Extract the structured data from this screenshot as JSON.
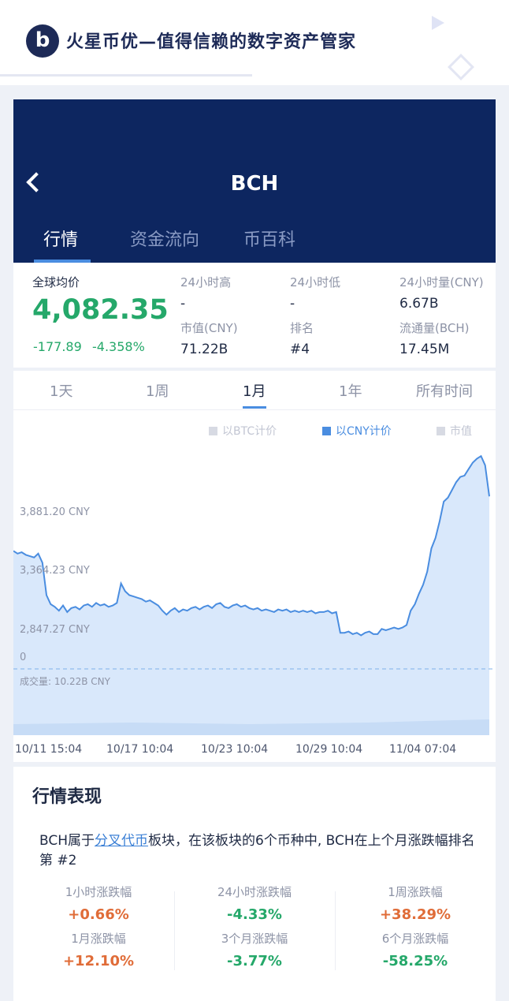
{
  "banner": {
    "logo_letter": "b",
    "title": "火星币优—值得信赖的数字资产管家"
  },
  "header": {
    "coin": "BCH",
    "tabs": [
      "行情",
      "资金流向",
      "币百科"
    ]
  },
  "stats": {
    "global_label": "全球均价",
    "price": "4,082.35",
    "change_abs": "-177.89",
    "change_pct": "-4.358%",
    "high_label": "24小时高",
    "high_value": "-",
    "low_label": "24小时低",
    "low_value": "-",
    "volume_label": "24小时量(CNY)",
    "volume_value": "6.67B",
    "mcap_label": "市值(CNY)",
    "mcap_value": "71.22B",
    "rank_label": "排名",
    "rank_value": "#4",
    "supply_label": "流通量(BCH)",
    "supply_value": "17.45M"
  },
  "ranges": {
    "items": [
      "1天",
      "1周",
      "1月",
      "1年",
      "所有时间"
    ],
    "active": "1月"
  },
  "chart_data": {
    "type": "area",
    "legend": [
      "以BTC计价",
      "以CNY计价",
      "市值"
    ],
    "active_series": "以CNY计价",
    "y_ticks": [
      "3,881.20 CNY",
      "3,364.23 CNY",
      "2,847.27 CNY",
      "0"
    ],
    "volume_label": "成交量: 10.22B CNY",
    "x_ticks": [
      "10/11 15:04",
      "10/17 10:04",
      "10/23 10:04",
      "10/29 10:04",
      "11/04 07:04"
    ],
    "ylim": [
      2500,
      4200
    ],
    "series": [
      {
        "name": "以CNY计价",
        "values": [
          3420,
          3400,
          3410,
          3390,
          3380,
          3370,
          3400,
          3330,
          3080,
          3010,
          2990,
          2960,
          3000,
          2950,
          2980,
          2990,
          2970,
          3000,
          3010,
          2990,
          3020,
          3000,
          3010,
          2990,
          3000,
          3020,
          3170,
          3110,
          3080,
          3070,
          3060,
          3050,
          3030,
          3040,
          3020,
          3000,
          2960,
          2930,
          2960,
          2980,
          2950,
          2970,
          2960,
          2980,
          2990,
          2970,
          2990,
          3000,
          2980,
          3010,
          3020,
          2990,
          2980,
          3000,
          3010,
          2990,
          3000,
          2980,
          2970,
          2980,
          2960,
          2970,
          2960,
          2950,
          2970,
          2960,
          2970,
          2950,
          2960,
          2950,
          2960,
          2950,
          2960,
          2940,
          2950,
          2950,
          2960,
          2940,
          2950,
          2790,
          2790,
          2800,
          2780,
          2790,
          2770,
          2790,
          2800,
          2780,
          2780,
          2820,
          2810,
          2820,
          2830,
          2820,
          2830,
          2850,
          2960,
          3010,
          3090,
          3160,
          3260,
          3440,
          3520,
          3650,
          3800,
          3830,
          3890,
          3950,
          3990,
          4000,
          4050,
          4100,
          4130,
          4150,
          4080,
          3840
        ]
      }
    ]
  },
  "perf": {
    "title": "行情表现",
    "desc_prefix": "BCH属于",
    "desc_link": "分叉代币",
    "desc_suffix": "板块，在该板块的6个币种中, BCH在上个月涨跌幅排名第 #2",
    "cells": [
      {
        "label": "1小时涨跌幅",
        "value": "+0.66%"
      },
      {
        "label": "24小时涨跌幅",
        "value": "-4.33%"
      },
      {
        "label": "1周涨跌幅",
        "value": "+38.29%"
      },
      {
        "label": "1月涨跌幅",
        "value": "+12.10%"
      },
      {
        "label": "3个月涨跌幅",
        "value": "-3.77%"
      },
      {
        "label": "6个月涨跌幅",
        "value": "-58.25%"
      }
    ]
  },
  "colors": {
    "header_bg": "#0d2660",
    "accent_blue": "#4a8de0",
    "up_color": "#e06c38",
    "down_color": "#25a86a"
  }
}
